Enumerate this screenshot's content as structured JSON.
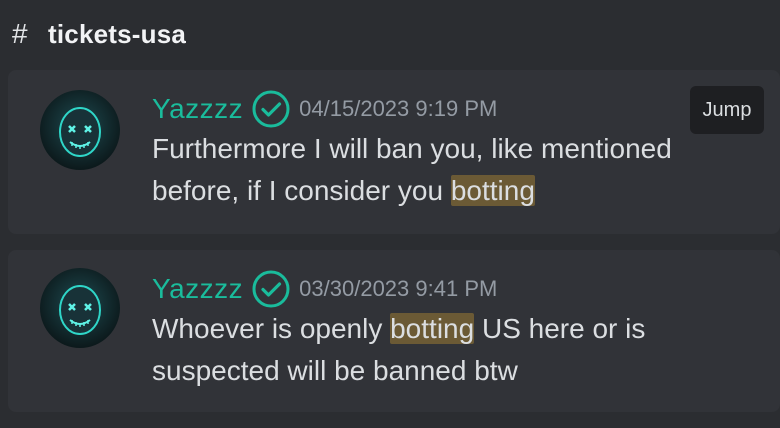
{
  "channel": {
    "hash_symbol": "#",
    "name": "tickets-usa"
  },
  "results": [
    {
      "username": "Yazzzz",
      "timestamp": "04/15/2023 9:19 PM",
      "text_before": "Furthermore I will ban you, like mentioned before, if I consider you ",
      "highlight": "botting",
      "text_after": "",
      "jump_label": "Jump"
    },
    {
      "username": "Yazzzz",
      "timestamp": "03/30/2023 9:41 PM",
      "text_before": "Whoever is openly ",
      "highlight": "botting",
      "text_after": " US here or is suspected will be banned btw"
    }
  ],
  "colors": {
    "background": "#2b2d31",
    "card": "#313338",
    "username": "#1abc9c",
    "highlight": "#6b5a35",
    "timestamp": "#949ba4"
  },
  "icons": {
    "verified": "check-circle-icon",
    "channel": "hash-icon"
  }
}
